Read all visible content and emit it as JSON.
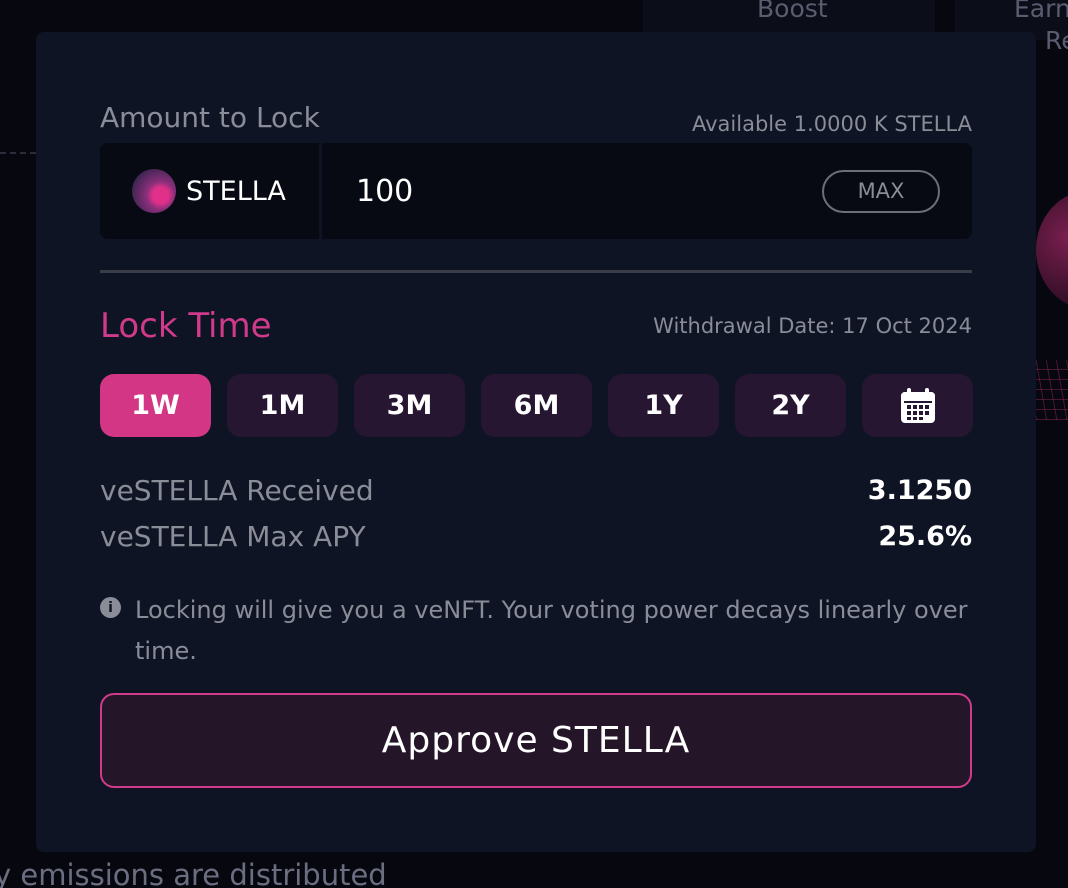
{
  "background": {
    "boost_label": "Boost",
    "earn_label": "Earn",
    "re_label": "Re",
    "bottom_text": "y emissions are distributed"
  },
  "lock_form": {
    "amount_label": "Amount to Lock",
    "available_text": "Available 1.0000 K STELLA",
    "token": {
      "name": "STELLA",
      "icon": "stella-token-icon"
    },
    "amount_value": "100",
    "max_label": "MAX",
    "lock_time_title": "Lock Time",
    "withdrawal_text": "Withdrawal Date: 17 Oct 2024",
    "periods": [
      {
        "label": "1W",
        "active": true
      },
      {
        "label": "1M",
        "active": false
      },
      {
        "label": "3M",
        "active": false
      },
      {
        "label": "6M",
        "active": false
      },
      {
        "label": "1Y",
        "active": false
      },
      {
        "label": "2Y",
        "active": false
      }
    ],
    "calendar_icon": "calendar-icon",
    "stats": [
      {
        "label": "veSTELLA Received",
        "value": "3.1250"
      },
      {
        "label": "veSTELLA Max APY",
        "value": "25.6%"
      }
    ],
    "note_icon": "info-icon",
    "note_text": "Locking will give you a veNFT. Your voting power decays linearly over time.",
    "approve_label": "Approve STELLA"
  },
  "colors": {
    "accent": "#d33685",
    "modal_bg": "#0e1424",
    "period_bg": "#261631"
  }
}
